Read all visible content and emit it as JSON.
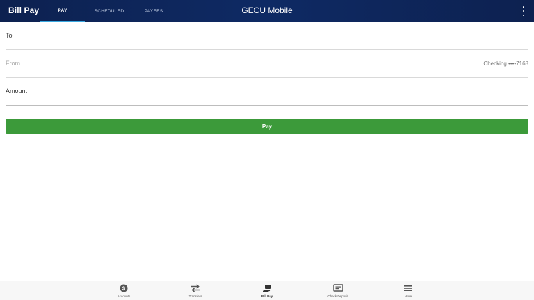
{
  "header": {
    "screen_title": "Bill Pay",
    "app_title": "GECU Mobile",
    "tabs": [
      {
        "label": "PAY",
        "active": true
      },
      {
        "label": "SCHEDULED",
        "active": false
      },
      {
        "label": "PAYEES",
        "active": false
      }
    ],
    "menu_icon": "more-vertical-icon"
  },
  "form": {
    "to_label": "To",
    "from_label": "From",
    "from_value": "Checking ••••7168",
    "amount_label": "Amount",
    "pay_button_label": "Pay"
  },
  "bottom_nav": {
    "items": [
      {
        "label": "Accounts",
        "icon": "dollar-circle-icon"
      },
      {
        "label": "Transfers",
        "icon": "transfer-arrows-icon"
      },
      {
        "label": "Bill Pay",
        "icon": "bill-pay-icon",
        "active": true
      },
      {
        "label": "Check Deposit",
        "icon": "check-deposit-icon"
      },
      {
        "label": "More",
        "icon": "menu-icon"
      }
    ]
  },
  "colors": {
    "header_bg": "#0e2a64",
    "tab_indicator": "#39a8e0",
    "pay_button": "#3c9a3a",
    "nav_bg": "#f7f7f7"
  }
}
